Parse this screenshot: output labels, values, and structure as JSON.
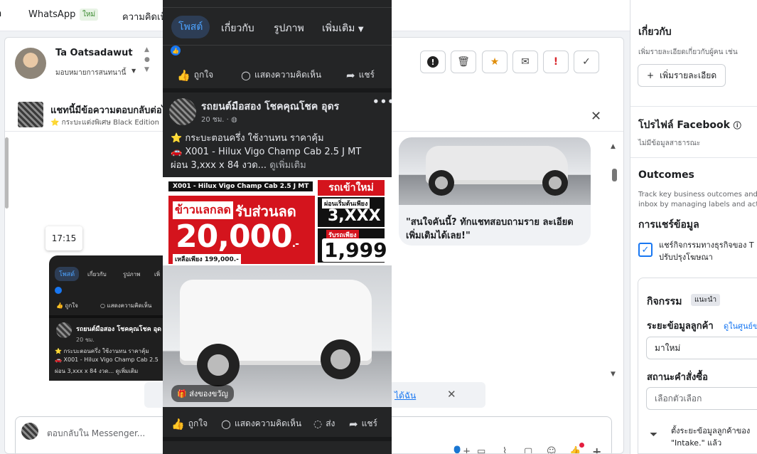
{
  "topbar": {
    "whatsapp": "WhatsApp",
    "new_badge": "ใหม่",
    "comments": "ความคิดเห็"
  },
  "conversation": {
    "name": "Ta Oatsadawut",
    "assign": "มอบหมายการสนทนานี้",
    "notice_title": "แชทนี้มีข้อความตอบกลับต่อไ",
    "notice_sub": "กระบะแต่งพิเศษ Black Edition",
    "card_caption": "\"สนใจคันนี้? ทักแชทสอบถามราย ละเอียดเพิ่มเติมได้เลย!\"",
    "time_tip": "17:15",
    "reply_placeholder": "ตอบกลับใน Messenger...",
    "link_text": "ได้ฉัน"
  },
  "mini_phone": {
    "tabs": [
      "โพสต์",
      "เกี่ยวกับ",
      "รูปภาพ",
      "เพิ่"
    ],
    "like": "ถูกใจ",
    "comment": "แสดงความคิดเห็น",
    "page": "รถยนต์มือสอง โชคคุณโชค อุด",
    "time": "20 ชม.",
    "line1": "⭐ กระบะตอนครึ่ง ใช้งานทน ราคาคุ้ม",
    "line2": "🚗 X001 - Hilux Vigo Champ Cab 2.5",
    "line3": "ผ่อน 3,xxx x 84 งวด... ดูเพิ่มเติม"
  },
  "phone": {
    "tabs": {
      "posts": "โพสต์",
      "about": "เกี่ยวกับ",
      "photos": "รูปภาพ",
      "more": "เพิ่มเติม"
    },
    "actions": {
      "like": "ถูกใจ",
      "comment": "แสดงความคิดเห็น",
      "share": "แชร์",
      "send": "ส่ง"
    },
    "post": {
      "page_name": "รถยนต์มือสอง โชคคุณโชค อุดร",
      "time": "20 ชม.",
      "line1": "⭐ กระบะตอนครึ่ง ใช้งานทน ราคาคุ้ม",
      "line2": "🚗 X001 - Hilux Vigo Champ Cab 2.5 J MT",
      "line3": "ผ่อน 3,xxx x 84 งวด...",
      "see_more": "ดูเพิ่มเติม"
    },
    "ad": {
      "model": "X001 - Hilux Vigo Champ Cab 2.5 J MT",
      "new_car": "รถเข้าใหม่",
      "trade": "ข้าวแลกลด",
      "discount": "รับส่วนลด",
      "amount": "20,000",
      "amount_unit": ".-",
      "installment_label": "ผ่อนเริ่มต้นเพียง",
      "installment": "3,XXX",
      "down_label": "รับรถเพียง",
      "down": "1,999",
      "remaining": "เหลือเพียง 199,000.-",
      "gift": "ส่งของขวัญ"
    }
  },
  "sidebar": {
    "about_title": "เกี่ยวกับ",
    "about_sub": "เพิ่มรายละเอียดเกี่ยวกับผู้คน เช่น",
    "add_details": "เพิ่มรายละเอียด",
    "fb_profile": "โปรไฟล์ Facebook",
    "no_public": "ไม่มีข้อมูลสาธารณะ",
    "outcomes": "Outcomes",
    "outcomes_sub1": "Track key business outcomes and o",
    "outcomes_sub2": "inbox by managing labels and activ",
    "data_sharing": "การแชร์ข้อมูล",
    "share_text1": "แชร์กิจกรรมทางธุรกิจของ T",
    "share_text2": "ปรับปรุงโฆษณา",
    "activity": "กิจกรรม",
    "recommended": "แนะนำ",
    "customer_stage": "ระยะข้อมูลลูกค้า",
    "customer_center": "ดูในศูนย์ข",
    "stage_value": "มาใหม่",
    "order_status": "สถานะคำสั่งซื้อ",
    "select_option": "เลือกตัวเลือก",
    "tip1": "ตั้งระยะข้อมูลลูกค้าของ",
    "tip2": "\"Intake.\" แล้ว"
  }
}
